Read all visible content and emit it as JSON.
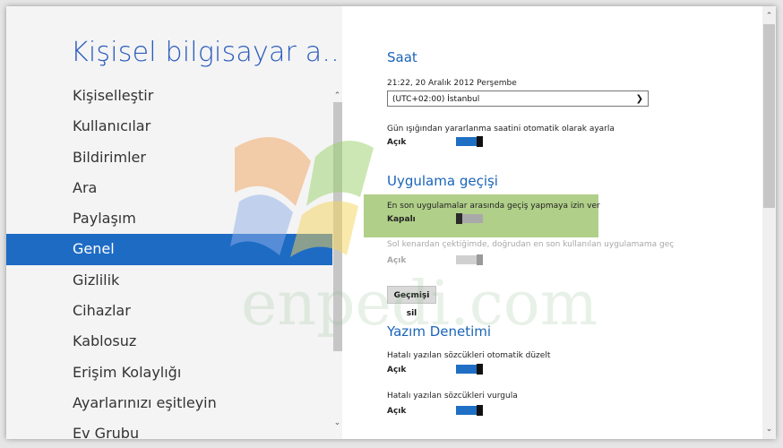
{
  "sidebar": {
    "title": "Kişisel bilgisayar a...",
    "items": [
      "Kişiselleştir",
      "Kullanıcılar",
      "Bildirimler",
      "Ara",
      "Paylaşım",
      "Genel",
      "Gizlilik",
      "Cihazlar",
      "Kablosuz",
      "Erişim Kolaylığı",
      "Ayarlarınızı eşitleyin",
      "Ev Grubu"
    ],
    "selected_index": 5
  },
  "clock": {
    "title": "Saat",
    "datetime": "21:22, 20 Aralık 2012 Perşembe",
    "timezone": "(UTC+02:00) İstanbul",
    "dst_label": "Gün ışığından yararlanma saatini otomatik olarak ayarla",
    "dst_state": "Açık"
  },
  "app_switching": {
    "title": "Uygulama geçişi",
    "recent_label": "En son uygulamalar arasında geçiş yapmaya izin ver",
    "recent_state": "Kapalı",
    "edge_label": "Sol kenardan çektiğimde, doğrudan en son kullanılan uygulamama geç",
    "edge_state": "Açık",
    "clear_button": "Geçmişi sil"
  },
  "spelling": {
    "title": "Yazım Denetimi",
    "autocorrect_label": "Hatalı yazılan sözcükleri otomatik düzelt",
    "autocorrect_state": "Açık",
    "highlight_label": "Hatalı yazılan sözcükleri vurgula",
    "highlight_state": "Açık"
  },
  "watermark": "enpedi.com",
  "colors": {
    "accent": "#1e6bc4",
    "highlight": "#70a828"
  }
}
